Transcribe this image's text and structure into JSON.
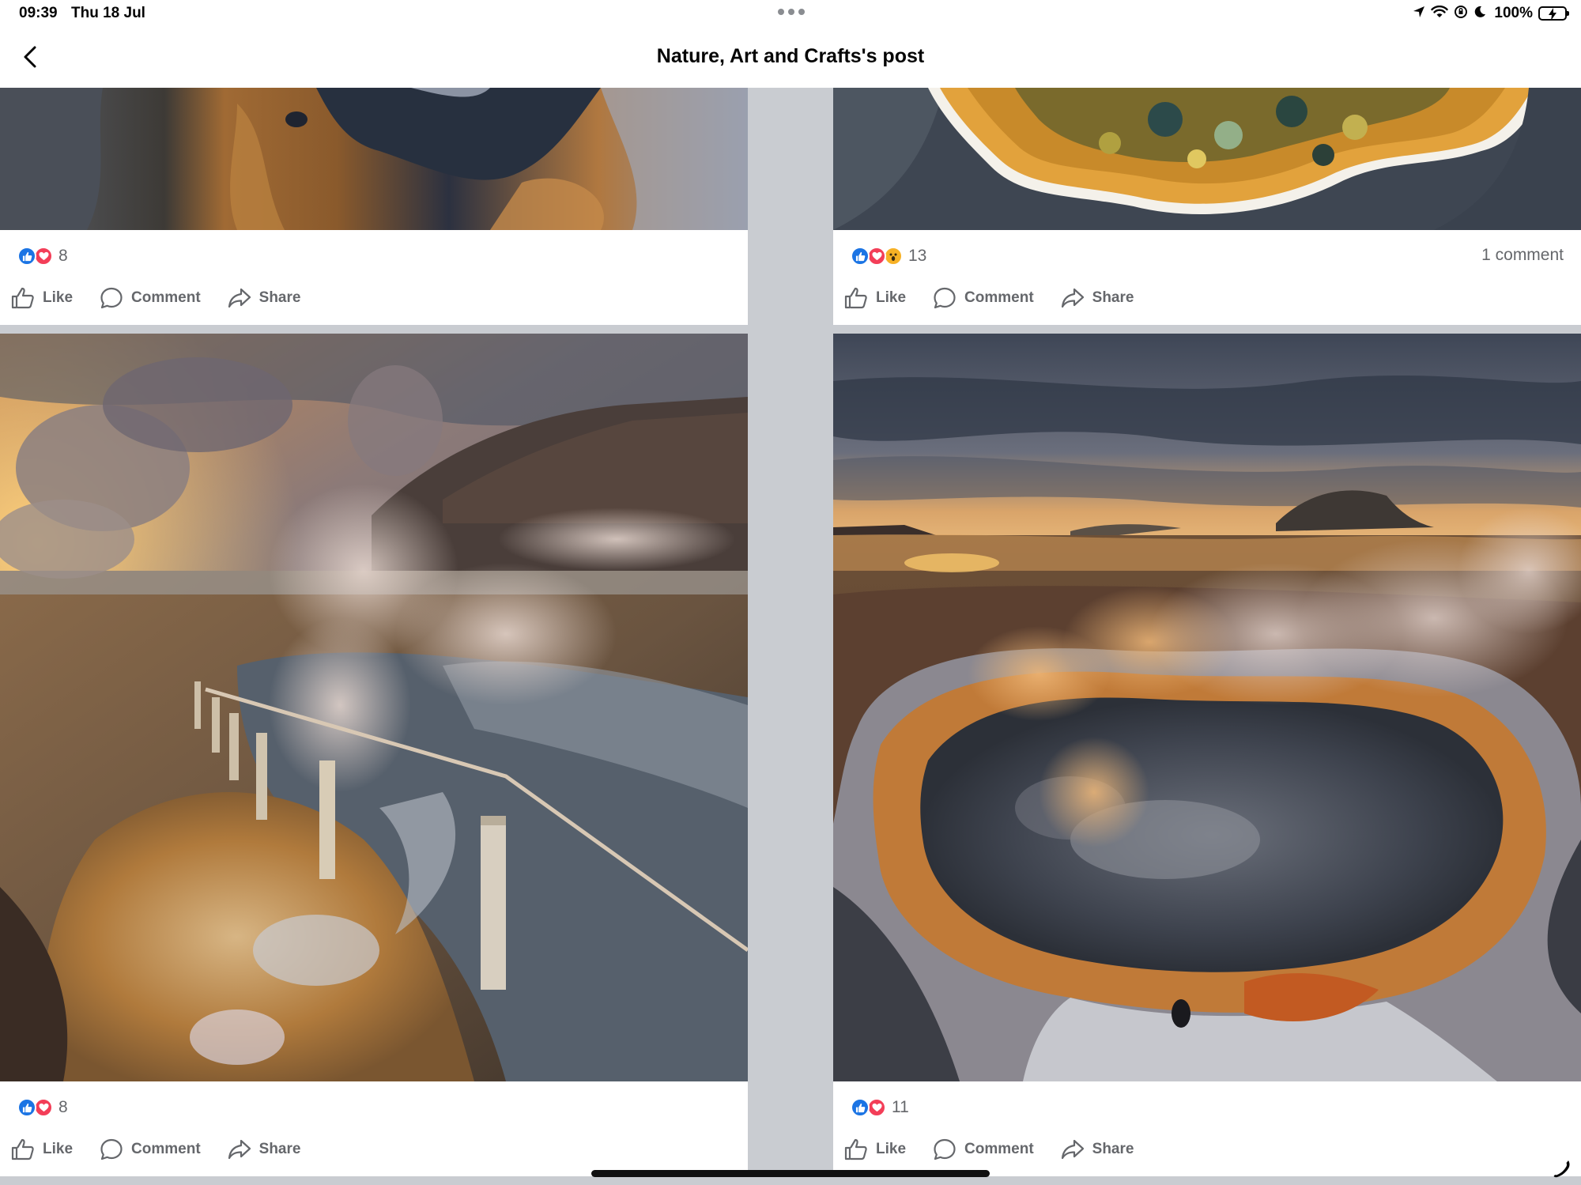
{
  "status_bar": {
    "time": "09:39",
    "date": "Thu 18 Jul",
    "battery_percent": "100%",
    "icons": [
      "location-arrow-icon",
      "wifi-icon",
      "screen-lock-rotation-icon",
      "do-not-disturb-moon-icon",
      "battery-charging-icon"
    ]
  },
  "header": {
    "title": "Nature, Art and Crafts's post",
    "back_icon": "chevron-left-icon"
  },
  "actions": {
    "like": "Like",
    "comment": "Comment",
    "share": "Share"
  },
  "posts": [
    {
      "reaction_count": "8",
      "reactions": [
        "like",
        "love"
      ],
      "comment_count": ""
    },
    {
      "reaction_count": "13",
      "reactions": [
        "like",
        "love",
        "wow"
      ],
      "comment_count": "1 comment"
    },
    {
      "reaction_count": "8",
      "reactions": [
        "like",
        "love"
      ],
      "comment_count": ""
    },
    {
      "reaction_count": "11",
      "reactions": [
        "like",
        "love"
      ],
      "comment_count": ""
    }
  ],
  "colors": {
    "like_blue": "#1b74e4",
    "love_red": "#f33e58",
    "wow_yellow": "#f7b125",
    "muted_text": "#65676b",
    "feed_gap": "#c9ccd1"
  }
}
